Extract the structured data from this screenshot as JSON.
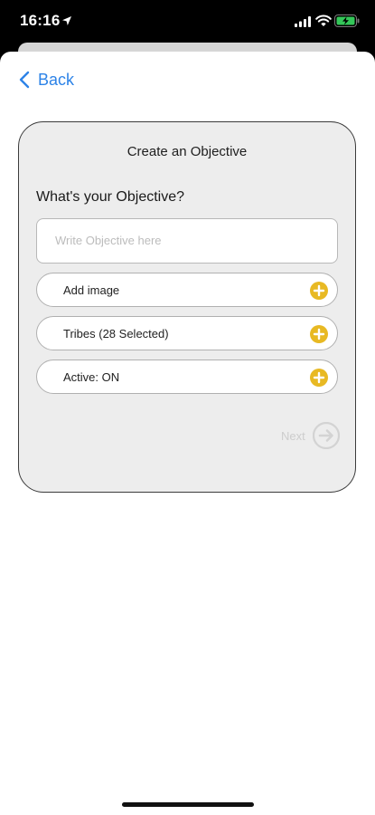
{
  "status": {
    "time": "16:16",
    "icons": [
      "location-arrow-icon",
      "signal-icon",
      "wifi-icon",
      "battery-charging-icon"
    ]
  },
  "nav": {
    "back_label": "Back",
    "back_icon": "chevron-left-icon"
  },
  "form": {
    "title": "Create an Objective",
    "question": "What's your Objective?",
    "objective_placeholder": "Write Objective here",
    "objective_value": "",
    "rows": [
      {
        "label": "Add image",
        "icon": "plus-circle-icon"
      },
      {
        "label": "Tribes (28 Selected)",
        "icon": "plus-circle-icon"
      },
      {
        "label": "Active: ON",
        "icon": "plus-circle-icon"
      }
    ],
    "next_label": "Next",
    "next_icon": "arrow-right-circle-icon"
  },
  "colors": {
    "accent": "#2d83e7",
    "plus": "#e8b923",
    "disabled": "#cdcdcd",
    "card_bg": "#ededed"
  }
}
